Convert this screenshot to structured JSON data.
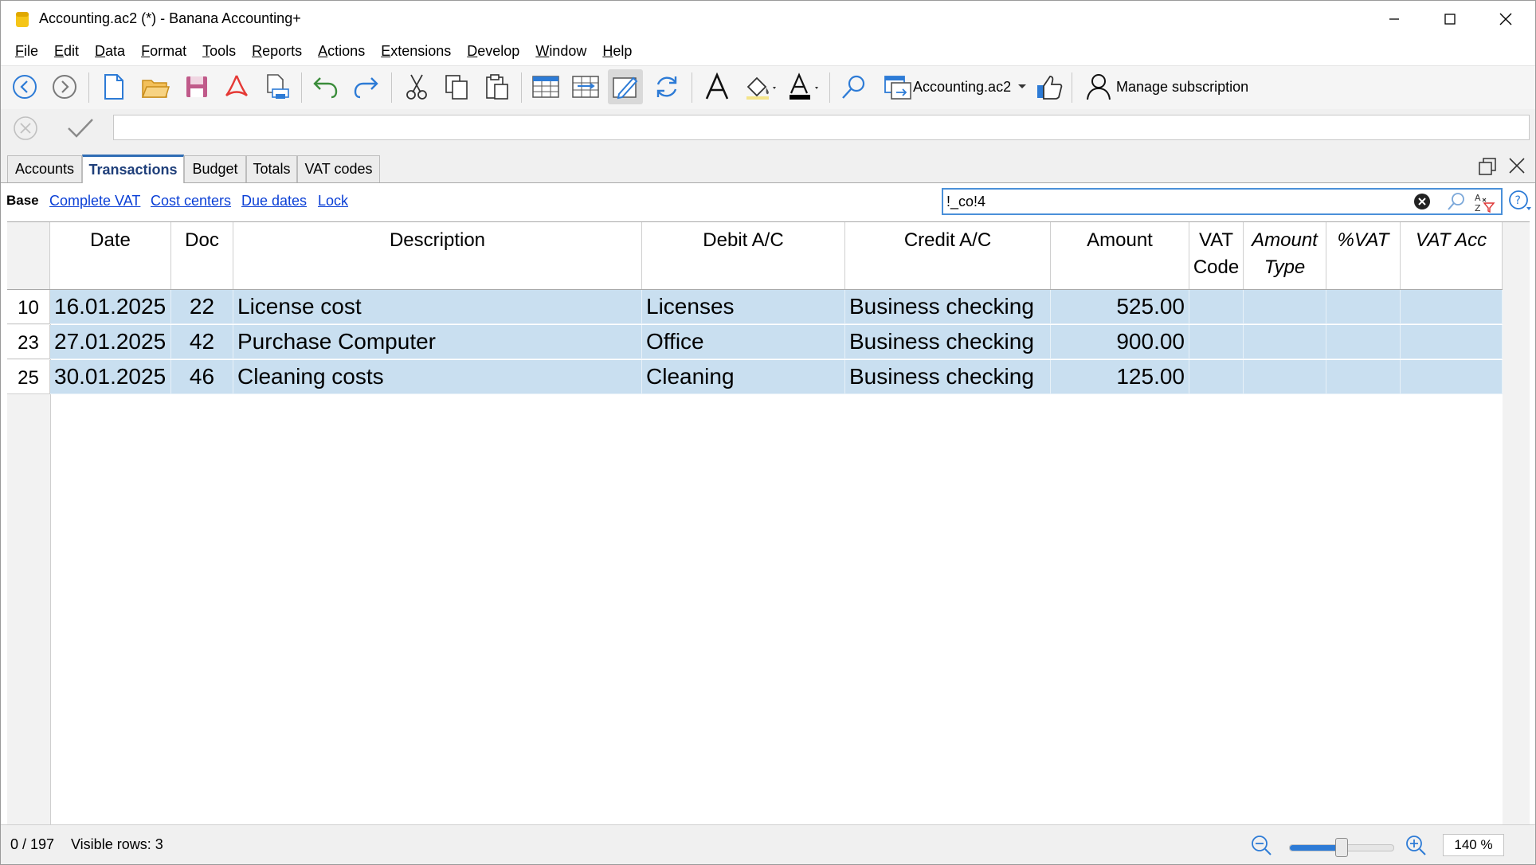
{
  "window": {
    "title": "Accounting.ac2 (*) - Banana Accounting+"
  },
  "menu": [
    {
      "first": "F",
      "rest": "ile"
    },
    {
      "first": "E",
      "rest": "dit"
    },
    {
      "first": "D",
      "rest": "ata"
    },
    {
      "first": "F",
      "rest": "ormat"
    },
    {
      "first": "T",
      "rest": "ools"
    },
    {
      "first": "R",
      "rest": "eports"
    },
    {
      "first": "A",
      "rest": "ctions"
    },
    {
      "first": "E",
      "rest": "xtensions"
    },
    {
      "first": "D",
      "rest": "evelop"
    },
    {
      "first": "W",
      "rest": "indow"
    },
    {
      "first": "H",
      "rest": "elp"
    }
  ],
  "toolbar": {
    "file_selector": "Accounting.ac2",
    "subscription": "Manage subscription"
  },
  "tabs": [
    "Accounts",
    "Transactions",
    "Budget",
    "Totals",
    "VAT codes"
  ],
  "views": {
    "base": "Base",
    "links": [
      "Complete VAT",
      "Cost centers",
      "Due dates",
      "Lock"
    ]
  },
  "search": {
    "value": "!_co!4"
  },
  "table": {
    "headers": {
      "date": "Date",
      "doc": "Doc",
      "description": "Description",
      "debit": "Debit A/C",
      "credit": "Credit A/C",
      "amount": "Amount",
      "vat_code_1": "VAT",
      "vat_code_2": "Code",
      "amount_type_1": "Amount",
      "amount_type_2": "Type",
      "pct_vat": "%VAT",
      "vat_acc": "VAT Acc"
    },
    "rows": [
      {
        "num": "10",
        "date": "16.01.2025",
        "doc": "22",
        "description": "License cost",
        "debit": "Licenses",
        "credit": "Business checking",
        "amount": "525.00"
      },
      {
        "num": "23",
        "date": "27.01.2025",
        "doc": "42",
        "description": "Purchase Computer",
        "debit": "Office",
        "credit": "Business checking",
        "amount": "900.00"
      },
      {
        "num": "25",
        "date": "30.01.2025",
        "doc": "46",
        "description": "Cleaning costs",
        "debit": "Cleaning",
        "credit": "Business checking",
        "amount": "125.00"
      }
    ]
  },
  "status": {
    "position": "0 / 197",
    "visible_rows": "Visible rows: 3",
    "zoom": "140 %",
    "zoom_slider_fraction": 0.5
  },
  "colors": {
    "selection": "#c9dff0",
    "link": "#0a3fd6",
    "accent": "#2f6db5"
  }
}
